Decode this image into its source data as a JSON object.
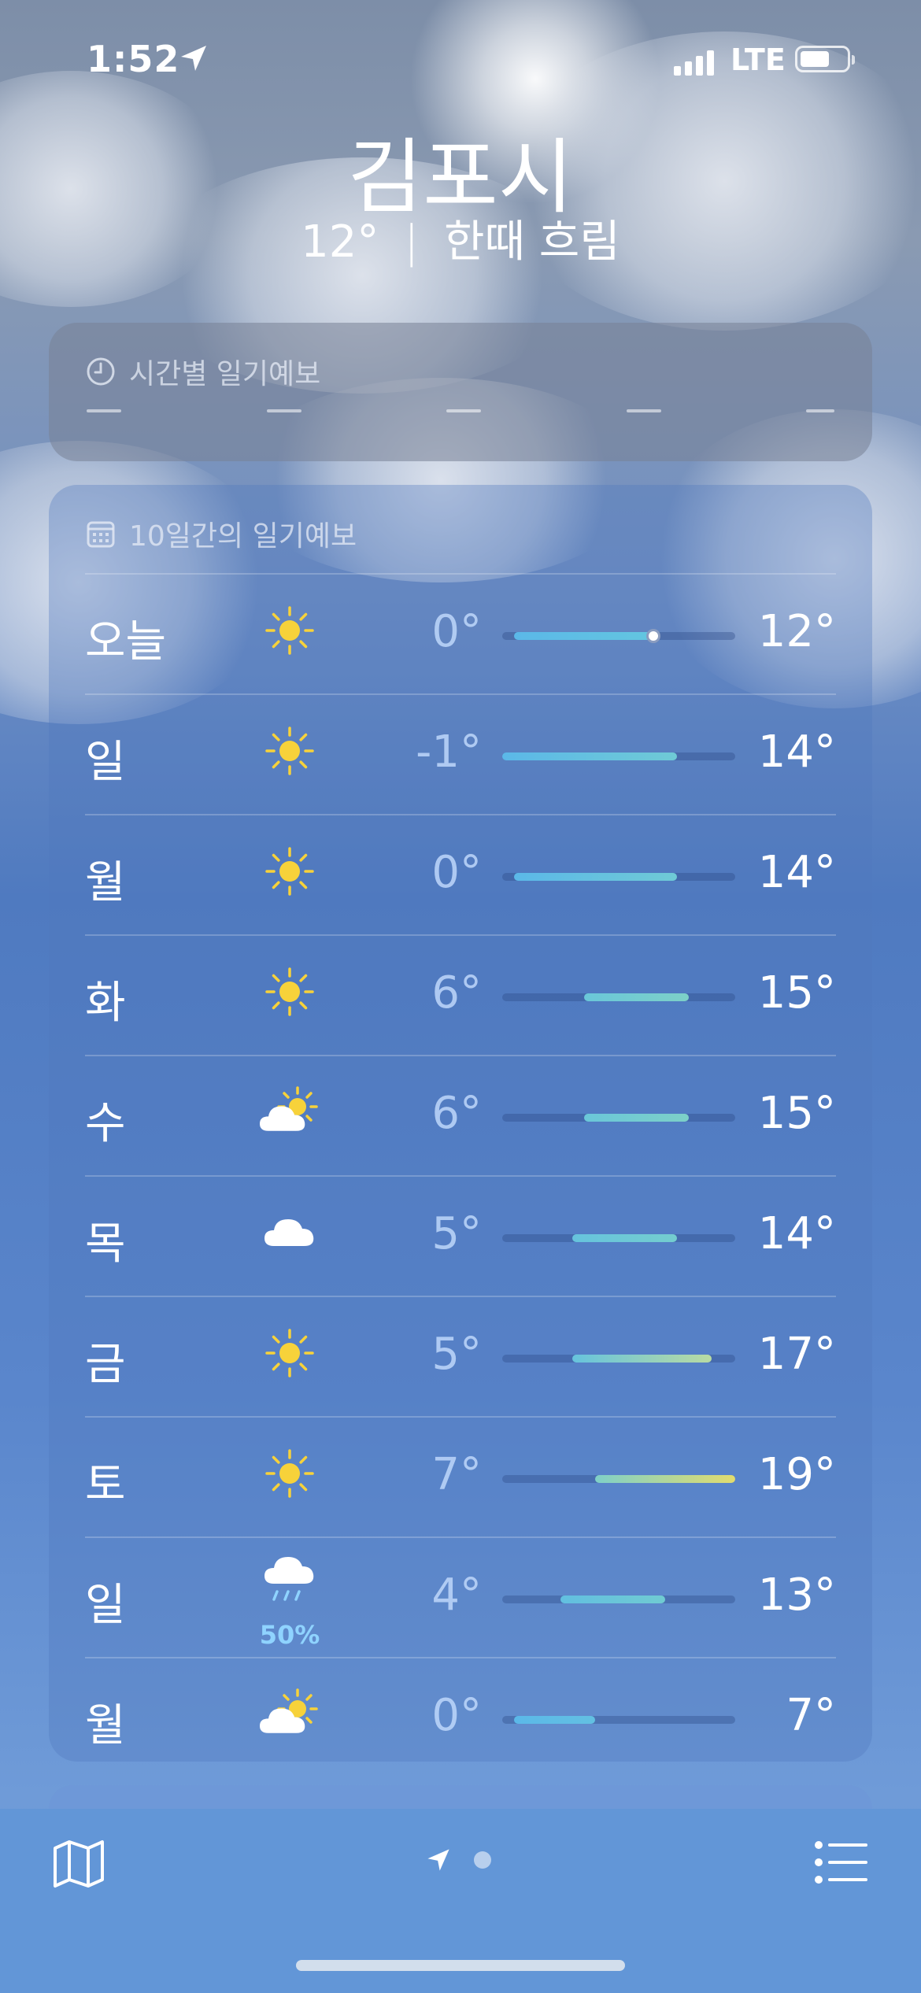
{
  "status_bar": {
    "time": "1:52",
    "network": "LTE"
  },
  "header": {
    "city": "김포시",
    "current_temp": "12°",
    "separator": "|",
    "condition": "한때 흐림"
  },
  "hourly": {
    "title": "시간별 일기예보",
    "icon": "clock-icon"
  },
  "daily": {
    "title": "10일간의 일기예보",
    "icon": "calendar-icon",
    "scale": {
      "min": -1,
      "max": 19
    },
    "current_temp_value": 12,
    "days": [
      {
        "day": "오늘",
        "icon": "sun",
        "low": "0°",
        "high": "12°",
        "low_v": 0,
        "high_v": 12,
        "colors": [
          "#5bb8e8",
          "#63c6e0"
        ],
        "show_now": true,
        "precip": ""
      },
      {
        "day": "일",
        "icon": "sun",
        "low": "-1°",
        "high": "14°",
        "low_v": -1,
        "high_v": 14,
        "colors": [
          "#5bb8e8",
          "#6fcad6"
        ],
        "show_now": false,
        "precip": ""
      },
      {
        "day": "월",
        "icon": "sun",
        "low": "0°",
        "high": "14°",
        "low_v": 0,
        "high_v": 14,
        "colors": [
          "#5bb8e8",
          "#6fcad6"
        ],
        "show_now": false,
        "precip": ""
      },
      {
        "day": "화",
        "icon": "sun",
        "low": "6°",
        "high": "15°",
        "low_v": 6,
        "high_v": 15,
        "colors": [
          "#6ac7d9",
          "#7dd0c8"
        ],
        "show_now": false,
        "precip": ""
      },
      {
        "day": "수",
        "icon": "partly-cloudy",
        "low": "6°",
        "high": "15°",
        "low_v": 6,
        "high_v": 15,
        "colors": [
          "#6ac7d9",
          "#7dd0c8"
        ],
        "show_now": false,
        "precip": ""
      },
      {
        "day": "목",
        "icon": "cloud",
        "low": "5°",
        "high": "14°",
        "low_v": 5,
        "high_v": 14,
        "colors": [
          "#66c3dd",
          "#74cdcf"
        ],
        "show_now": false,
        "precip": ""
      },
      {
        "day": "금",
        "icon": "sun",
        "low": "5°",
        "high": "17°",
        "low_v": 5,
        "high_v": 17,
        "colors": [
          "#66c3dd",
          "#b9dba2"
        ],
        "show_now": false,
        "precip": ""
      },
      {
        "day": "토",
        "icon": "sun",
        "low": "7°",
        "high": "19°",
        "low_v": 7,
        "high_v": 19,
        "colors": [
          "#7fd0c8",
          "#e2dc6e"
        ],
        "show_now": false,
        "precip": ""
      },
      {
        "day": "일",
        "icon": "rain",
        "low": "4°",
        "high": "13°",
        "low_v": 4,
        "high_v": 13,
        "colors": [
          "#62bfe0",
          "#70cbd2"
        ],
        "show_now": false,
        "precip": "50%"
      },
      {
        "day": "월",
        "icon": "partly-cloudy",
        "low": "0°",
        "high": "7°",
        "low_v": 0,
        "high_v": 7,
        "colors": [
          "#5bb8e8",
          "#63c0e2"
        ],
        "show_now": false,
        "precip": ""
      }
    ]
  },
  "toolbar": {
    "map_icon": "map-icon",
    "location_icon": "location-arrow-icon",
    "list_icon": "list-icon"
  },
  "colors": {
    "sun": "#f7d23a",
    "precip": "#8fd3ff"
  }
}
